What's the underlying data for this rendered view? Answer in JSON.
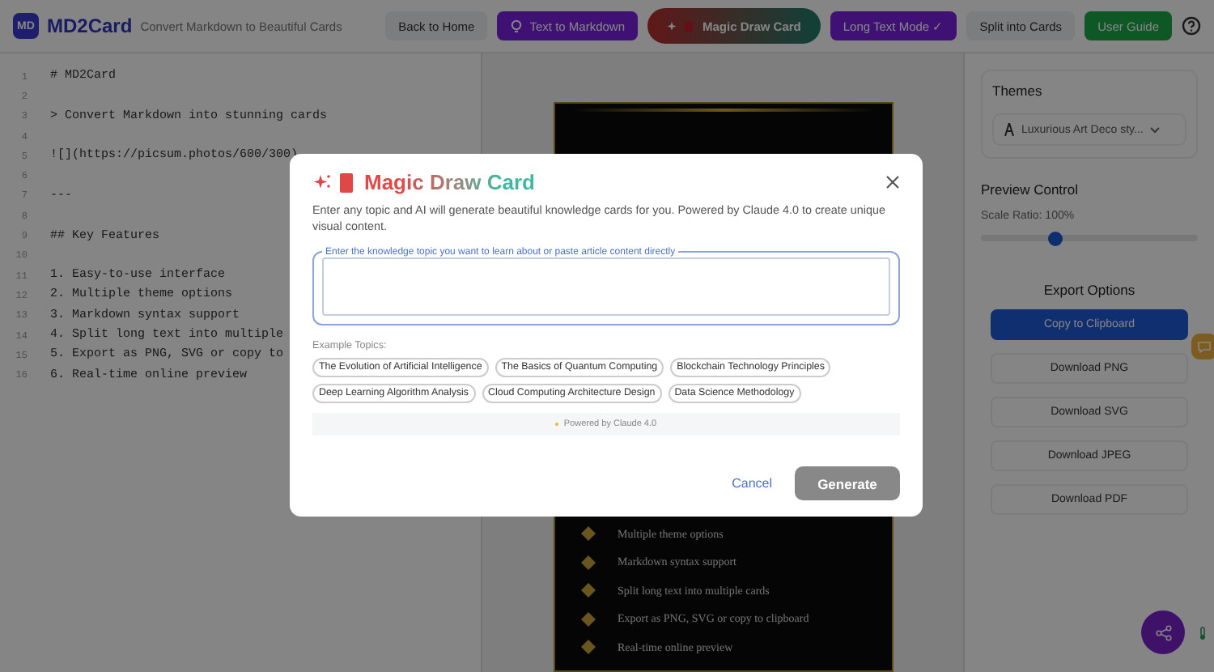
{
  "header": {
    "logo": "MD",
    "title": "MD2Card",
    "subtitle": "Convert Markdown to Beautiful Cards",
    "nav": [
      {
        "label": "Back to Home",
        "kind": "plain"
      },
      {
        "label": "Text to Markdown",
        "kind": "purple"
      },
      {
        "label": "Magic Draw Card",
        "kind": "gradient"
      },
      {
        "label": "Long Text Mode ✓",
        "kind": "purple"
      },
      {
        "label": "Split into Cards",
        "kind": "plain"
      },
      {
        "label": "User Guide",
        "kind": "green"
      }
    ]
  },
  "editor": {
    "lines": [
      {
        "number": "1",
        "text": "# MD2Card"
      },
      {
        "number": "2"
      },
      {
        "number": "3",
        "text": "> Convert Markdown into stunning cards"
      },
      {
        "number": "4"
      },
      {
        "number": "5",
        "text": "![](https://picsum.photos/600/300)"
      },
      {
        "number": "6"
      },
      {
        "number": "7",
        "text": "---"
      },
      {
        "number": "8"
      },
      {
        "number": "9",
        "text": "## Key Features"
      },
      {
        "number": "10"
      },
      {
        "number": "11",
        "text": "1. Easy-to-use interface"
      },
      {
        "number": "12",
        "text": "2. Multiple theme options"
      },
      {
        "number": "13",
        "text": "3. Markdown syntax support"
      },
      {
        "number": "14",
        "text": "4. Split long text into multiple"
      },
      {
        "number": "15",
        "text": "5. Export as PNG, SVG or copy to"
      },
      {
        "number": "16",
        "text": "6. Real-time online preview"
      }
    ]
  },
  "preview": {
    "items": [
      "Multiple theme options",
      "Markdown syntax support",
      "Split long text into multiple cards",
      "Export as PNG, SVG or copy to clipboard",
      "Real-time online preview"
    ]
  },
  "sidebar": {
    "themes_title": "Themes",
    "theme_select": "Luxurious Art Deco sty...",
    "preview_title": "Preview Control",
    "scale_label": "Scale Ratio: 100%",
    "scale": {
      "level": 0.34
    },
    "export_title": "Export Options",
    "export_buttons": [
      {
        "label": "Copy to Clipboard",
        "selected": true
      },
      {
        "label": "Download PNG",
        "selected": false
      },
      {
        "label": "Download SVG",
        "selected": false
      },
      {
        "label": "Download JPEG",
        "selected": false
      },
      {
        "label": "Download PDF",
        "selected": false
      }
    ]
  },
  "modal": {
    "title": "Magic Draw Card",
    "description": "Enter any topic and AI will generate beautiful knowledge cards for you. Powered by Claude 4.0 to create unique visual content.",
    "input_label": "Enter the knowledge topic you want to learn about or paste article content directly",
    "examples_title": "Example Topics:",
    "examples": [
      "The Evolution of Artificial Intelligence",
      "The Basics of Quantum Computing",
      "Blockchain Technology Principles",
      "Deep Learning Algorithm Analysis",
      "Cloud Computing Architecture Design",
      "Data Science Methodology"
    ],
    "powered": "Powered by Claude 4.0",
    "cancel": "Cancel",
    "generate": {
      "label": "Generate",
      "disabled": true
    }
  }
}
